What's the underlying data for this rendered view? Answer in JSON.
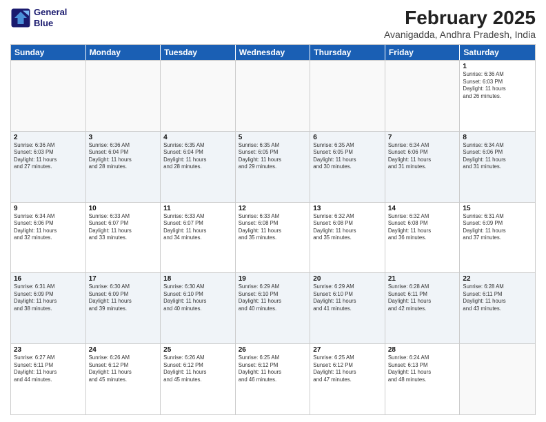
{
  "header": {
    "logo_line1": "General",
    "logo_line2": "Blue",
    "month": "February 2025",
    "location": "Avanigadda, Andhra Pradesh, India"
  },
  "day_headers": [
    "Sunday",
    "Monday",
    "Tuesday",
    "Wednesday",
    "Thursday",
    "Friday",
    "Saturday"
  ],
  "weeks": [
    {
      "alt": false,
      "days": [
        {
          "num": "",
          "info": ""
        },
        {
          "num": "",
          "info": ""
        },
        {
          "num": "",
          "info": ""
        },
        {
          "num": "",
          "info": ""
        },
        {
          "num": "",
          "info": ""
        },
        {
          "num": "",
          "info": ""
        },
        {
          "num": "1",
          "info": "Sunrise: 6:36 AM\nSunset: 6:03 PM\nDaylight: 11 hours\nand 26 minutes."
        }
      ]
    },
    {
      "alt": true,
      "days": [
        {
          "num": "2",
          "info": "Sunrise: 6:36 AM\nSunset: 6:03 PM\nDaylight: 11 hours\nand 27 minutes."
        },
        {
          "num": "3",
          "info": "Sunrise: 6:36 AM\nSunset: 6:04 PM\nDaylight: 11 hours\nand 28 minutes."
        },
        {
          "num": "4",
          "info": "Sunrise: 6:35 AM\nSunset: 6:04 PM\nDaylight: 11 hours\nand 28 minutes."
        },
        {
          "num": "5",
          "info": "Sunrise: 6:35 AM\nSunset: 6:05 PM\nDaylight: 11 hours\nand 29 minutes."
        },
        {
          "num": "6",
          "info": "Sunrise: 6:35 AM\nSunset: 6:05 PM\nDaylight: 11 hours\nand 30 minutes."
        },
        {
          "num": "7",
          "info": "Sunrise: 6:34 AM\nSunset: 6:06 PM\nDaylight: 11 hours\nand 31 minutes."
        },
        {
          "num": "8",
          "info": "Sunrise: 6:34 AM\nSunset: 6:06 PM\nDaylight: 11 hours\nand 31 minutes."
        }
      ]
    },
    {
      "alt": false,
      "days": [
        {
          "num": "9",
          "info": "Sunrise: 6:34 AM\nSunset: 6:06 PM\nDaylight: 11 hours\nand 32 minutes."
        },
        {
          "num": "10",
          "info": "Sunrise: 6:33 AM\nSunset: 6:07 PM\nDaylight: 11 hours\nand 33 minutes."
        },
        {
          "num": "11",
          "info": "Sunrise: 6:33 AM\nSunset: 6:07 PM\nDaylight: 11 hours\nand 34 minutes."
        },
        {
          "num": "12",
          "info": "Sunrise: 6:33 AM\nSunset: 6:08 PM\nDaylight: 11 hours\nand 35 minutes."
        },
        {
          "num": "13",
          "info": "Sunrise: 6:32 AM\nSunset: 6:08 PM\nDaylight: 11 hours\nand 35 minutes."
        },
        {
          "num": "14",
          "info": "Sunrise: 6:32 AM\nSunset: 6:08 PM\nDaylight: 11 hours\nand 36 minutes."
        },
        {
          "num": "15",
          "info": "Sunrise: 6:31 AM\nSunset: 6:09 PM\nDaylight: 11 hours\nand 37 minutes."
        }
      ]
    },
    {
      "alt": true,
      "days": [
        {
          "num": "16",
          "info": "Sunrise: 6:31 AM\nSunset: 6:09 PM\nDaylight: 11 hours\nand 38 minutes."
        },
        {
          "num": "17",
          "info": "Sunrise: 6:30 AM\nSunset: 6:09 PM\nDaylight: 11 hours\nand 39 minutes."
        },
        {
          "num": "18",
          "info": "Sunrise: 6:30 AM\nSunset: 6:10 PM\nDaylight: 11 hours\nand 40 minutes."
        },
        {
          "num": "19",
          "info": "Sunrise: 6:29 AM\nSunset: 6:10 PM\nDaylight: 11 hours\nand 40 minutes."
        },
        {
          "num": "20",
          "info": "Sunrise: 6:29 AM\nSunset: 6:10 PM\nDaylight: 11 hours\nand 41 minutes."
        },
        {
          "num": "21",
          "info": "Sunrise: 6:28 AM\nSunset: 6:11 PM\nDaylight: 11 hours\nand 42 minutes."
        },
        {
          "num": "22",
          "info": "Sunrise: 6:28 AM\nSunset: 6:11 PM\nDaylight: 11 hours\nand 43 minutes."
        }
      ]
    },
    {
      "alt": false,
      "days": [
        {
          "num": "23",
          "info": "Sunrise: 6:27 AM\nSunset: 6:11 PM\nDaylight: 11 hours\nand 44 minutes."
        },
        {
          "num": "24",
          "info": "Sunrise: 6:26 AM\nSunset: 6:12 PM\nDaylight: 11 hours\nand 45 minutes."
        },
        {
          "num": "25",
          "info": "Sunrise: 6:26 AM\nSunset: 6:12 PM\nDaylight: 11 hours\nand 45 minutes."
        },
        {
          "num": "26",
          "info": "Sunrise: 6:25 AM\nSunset: 6:12 PM\nDaylight: 11 hours\nand 46 minutes."
        },
        {
          "num": "27",
          "info": "Sunrise: 6:25 AM\nSunset: 6:12 PM\nDaylight: 11 hours\nand 47 minutes."
        },
        {
          "num": "28",
          "info": "Sunrise: 6:24 AM\nSunset: 6:13 PM\nDaylight: 11 hours\nand 48 minutes."
        },
        {
          "num": "",
          "info": ""
        }
      ]
    }
  ]
}
